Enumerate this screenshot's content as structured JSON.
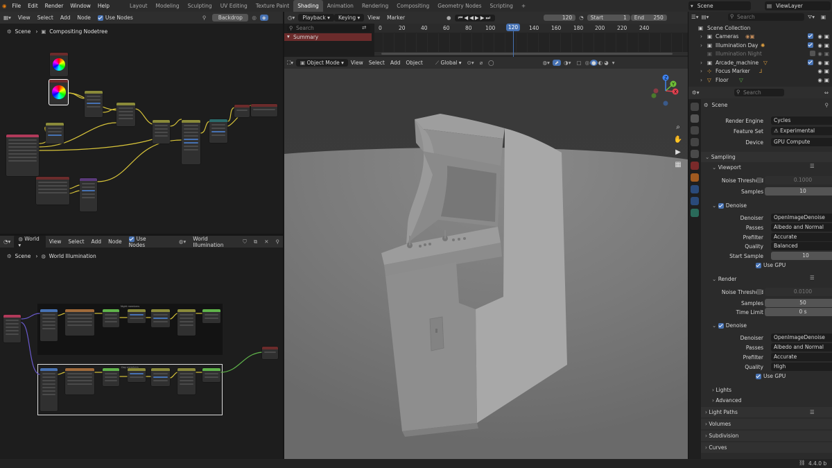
{
  "menu": [
    "File",
    "Edit",
    "Render",
    "Window",
    "Help"
  ],
  "workspaces": [
    "Layout",
    "Modeling",
    "Sculpting",
    "UV Editing",
    "Texture Paint",
    "Shading",
    "Animation",
    "Rendering",
    "Compositing",
    "Geometry Nodes",
    "Scripting",
    "+"
  ],
  "active_workspace_index": 5,
  "top_right": {
    "scene": "Scene",
    "view_layer": "ViewLayer"
  },
  "compositor": {
    "header": {
      "view": "View",
      "select": "Select",
      "add": "Add",
      "node": "Node",
      "use_nodes": "Use Nodes",
      "backdrop": "Backdrop"
    },
    "breadcrumb": {
      "scene": "Scene",
      "tree": "Compositing Nodetree"
    }
  },
  "world_editor": {
    "header": {
      "type": "World",
      "view": "View",
      "select": "Select",
      "add": "Add",
      "node": "Node",
      "use_nodes": "Use Nodes",
      "world_name": "World Illumination"
    },
    "breadcrumb": {
      "scene": "Scene",
      "world": "World Illumination"
    },
    "frame_labels": {
      "top": "Night members",
      "bottom": "Day members"
    }
  },
  "timeline": {
    "header": {
      "playback": "Playback",
      "keying": "Keying",
      "view": "View",
      "marker": "Marker",
      "current": "120",
      "start_label": "Start",
      "start": "1",
      "end_label": "End",
      "end": "250"
    },
    "search_placeholder": "Search",
    "summary": "Summary",
    "ticks": [
      "0",
      "20",
      "40",
      "60",
      "80",
      "100",
      "120",
      "140",
      "160",
      "180",
      "200",
      "220",
      "240"
    ],
    "current_frame": "120"
  },
  "viewport": {
    "header": {
      "mode": "Object Mode",
      "view": "View",
      "select": "Select",
      "add": "Add",
      "object": "Object",
      "orientation": "Global"
    },
    "gizmo": {
      "x": "X",
      "y": "Y",
      "z": "Z"
    }
  },
  "outliner": {
    "search_placeholder": "Search",
    "root": "Scene Collection",
    "items": [
      {
        "name": "Cameras",
        "enabled": true
      },
      {
        "name": "Illumination Day",
        "enabled": true
      },
      {
        "name": "Illumination Night",
        "enabled": false
      },
      {
        "name": "Arcade_machine",
        "enabled": true
      },
      {
        "name": "Focus Marker",
        "enabled": true
      },
      {
        "name": "Floor",
        "enabled": true
      }
    ]
  },
  "properties": {
    "search_placeholder": "Search",
    "context": "Scene",
    "render_engine": {
      "label": "Render Engine",
      "value": "Cycles"
    },
    "feature_set": {
      "label": "Feature Set",
      "value": "Experimental"
    },
    "device": {
      "label": "Device",
      "value": "GPU Compute"
    },
    "sampling": "Sampling",
    "viewport_panel": {
      "title": "Viewport",
      "noise_threshold": {
        "label": "Noise Threshold",
        "value": "0.1000"
      },
      "samples": {
        "label": "Samples",
        "value": "10"
      },
      "denoise": "Denoise",
      "denoiser": {
        "label": "Denoiser",
        "value": "OpenImageDenoise"
      },
      "passes": {
        "label": "Passes",
        "value": "Albedo and Normal"
      },
      "prefilter": {
        "label": "Prefilter",
        "value": "Accurate"
      },
      "quality": {
        "label": "Quality",
        "value": "Balanced"
      },
      "start_sample": {
        "label": "Start Sample",
        "value": "10"
      },
      "use_gpu": "Use GPU"
    },
    "render_panel": {
      "title": "Render",
      "noise_threshold": {
        "label": "Noise Threshold",
        "value": "0.0100"
      },
      "samples": {
        "label": "Samples",
        "value": "50"
      },
      "time_limit": {
        "label": "Time Limit",
        "value": "0 s"
      },
      "denoise": "Denoise",
      "denoiser": {
        "label": "Denoiser",
        "value": "OpenImageDenoise"
      },
      "passes": {
        "label": "Passes",
        "value": "Albedo and Normal"
      },
      "prefilter": {
        "label": "Prefilter",
        "value": "Accurate"
      },
      "quality": {
        "label": "Quality",
        "value": "High"
      },
      "use_gpu": "Use GPU"
    },
    "lights": "Lights",
    "advanced": "Advanced",
    "light_paths": "Light Paths",
    "volumes": "Volumes",
    "subdivision": "Subdivision",
    "curves": "Curves"
  },
  "status": {
    "version": "4.4.0 b"
  },
  "colors": {
    "accent": "#4772b3",
    "playhead": "#4772b3",
    "summary": "#6b2b2b",
    "node_yellow": "#d8c43a",
    "node_green": "#5fb34a"
  }
}
